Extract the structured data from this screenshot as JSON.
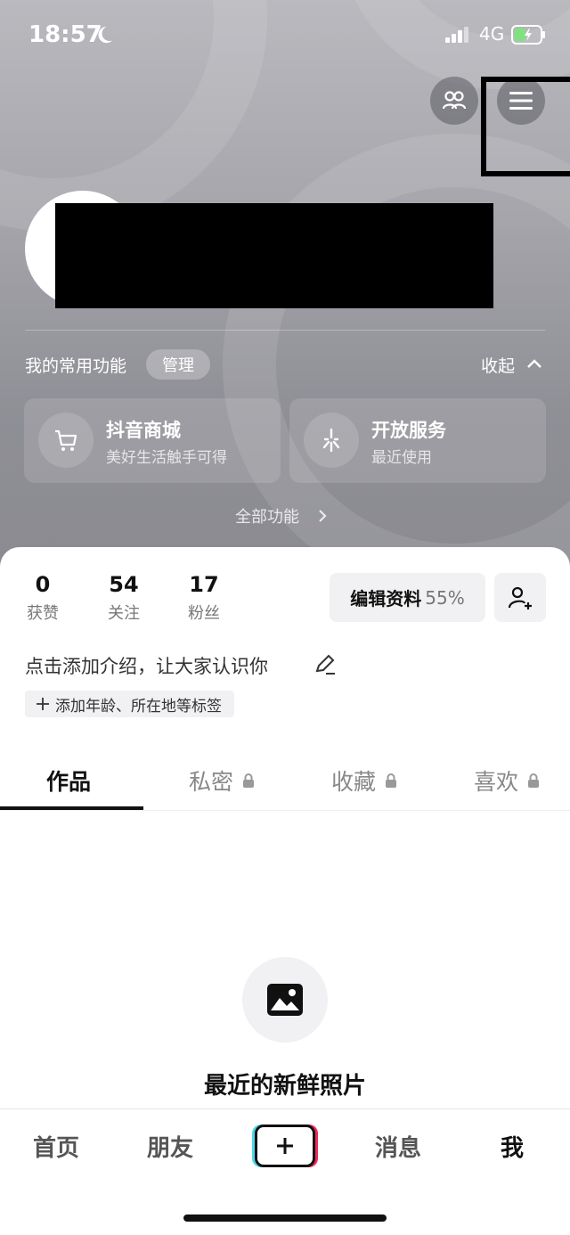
{
  "status_bar": {
    "time": "18:57",
    "network": "4G"
  },
  "functions": {
    "title": "我的常用功能",
    "manage": "管理",
    "collapse": "收起",
    "cards": [
      {
        "title": "抖音商城",
        "subtitle": "美好生活触手可得",
        "icon": "cart-icon"
      },
      {
        "title": "开放服务",
        "subtitle": "最近使用",
        "icon": "sparkle-icon"
      }
    ],
    "all": "全部功能"
  },
  "stats": [
    {
      "value": "0",
      "label": "获赞"
    },
    {
      "value": "54",
      "label": "关注"
    },
    {
      "value": "17",
      "label": "粉丝"
    }
  ],
  "profile": {
    "edit_label": "编辑资料",
    "edit_percent": "55%",
    "bio_placeholder": "点击添加介绍，让大家认识你",
    "tag_chip": "添加年龄、所在地等标签"
  },
  "tabs": [
    {
      "label": "作品",
      "locked": false
    },
    {
      "label": "私密",
      "locked": true
    },
    {
      "label": "收藏",
      "locked": true
    },
    {
      "label": "喜欢",
      "locked": true
    }
  ],
  "empty_state": {
    "title": "最近的新鲜照片"
  },
  "bottom_nav": {
    "home": "首页",
    "friends": "朋友",
    "messages": "消息",
    "me": "我"
  },
  "colors": {
    "tab_active": "#111111",
    "accent_cyan": "#4fd8e8",
    "accent_red": "#ee2a5a"
  }
}
